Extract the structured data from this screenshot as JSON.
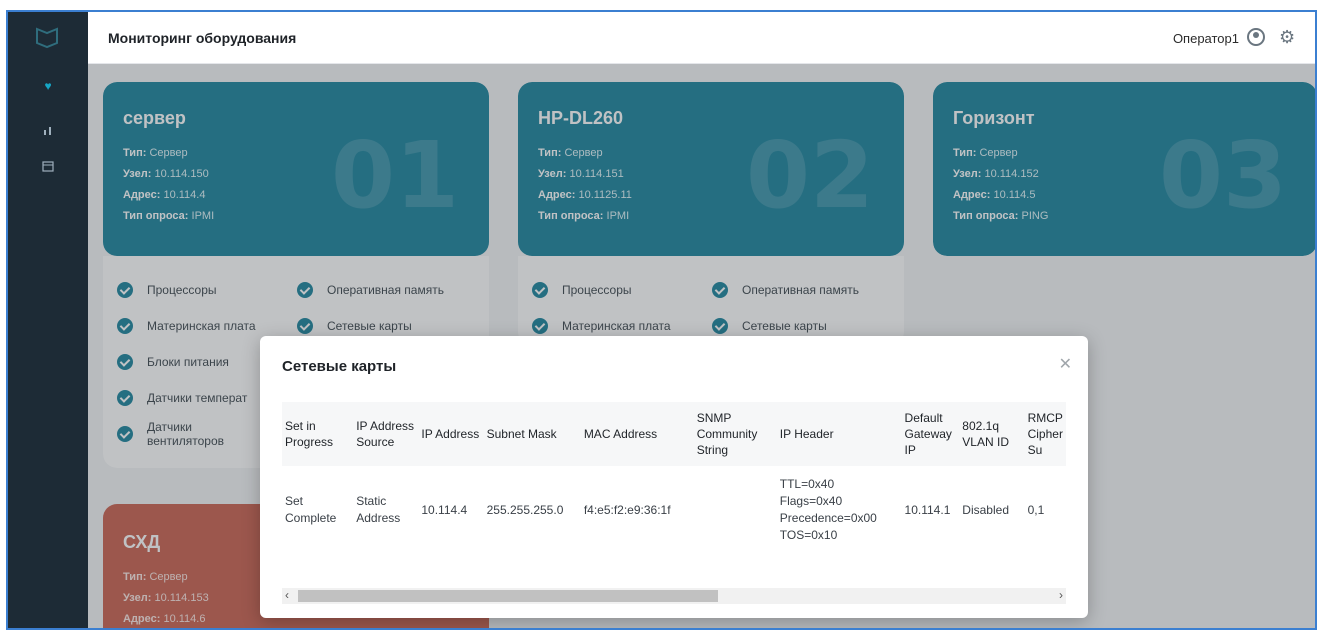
{
  "topbar": {
    "title": "Мониторинг оборудования",
    "user": "Оператор1"
  },
  "sidebar": {
    "items": [
      "logo-icon",
      "heart-icon",
      "chart-icon",
      "calendar-icon"
    ]
  },
  "labels": {
    "type": "Тип:",
    "node": "Узел:",
    "address": "Адрес:",
    "poll": "Тип опроса:"
  },
  "cards": [
    {
      "name": "сервер",
      "number": "01",
      "type": "Сервер",
      "node": "10.114.150",
      "address": "10.114.4",
      "poll": "IPMI",
      "features": [
        "Процессоры",
        "Оперативная память",
        "Материнская плата",
        "Сетевые карты",
        "Блоки питания",
        "Датчики температ",
        "Датчики вентиляторов"
      ]
    },
    {
      "name": "HP-DL260",
      "number": "02",
      "type": "Сервер",
      "node": "10.114.151",
      "address": "10.1125.11",
      "poll": "IPMI",
      "features": [
        "Процессоры",
        "Оперативная память",
        "Материнская плата",
        "Сетевые карты"
      ]
    },
    {
      "name": "Горизонт",
      "number": "03",
      "type": "Сервер",
      "node": "10.114.152",
      "address": "10.114.5",
      "poll": "PING"
    },
    {
      "name": "СХД",
      "type": "Сервер",
      "node": "10.114.153",
      "address": "10.114.6"
    }
  ],
  "modal": {
    "title": "Сетевые карты",
    "headers": [
      "Set in Progress",
      "IP Address Source",
      "IP Address",
      "Subnet Mask",
      "MAC Address",
      "SNMP Community String",
      "IP Header",
      "Default Gateway IP",
      "802.1q VLAN ID",
      "RMCP Cipher Su"
    ],
    "row": [
      "Set Complete",
      "Static Address",
      "10.114.4",
      "255.255.255.0",
      "f4:e5:f2:e9:36:1f",
      "",
      "TTL=0x40 Flags=0x40 Precedence=0x00 TOS=0x10",
      "10.114.1",
      "Disabled",
      "0,1"
    ]
  },
  "colors": {
    "card_teal": "#0e7c97",
    "card_red": "#c75846",
    "sidebar": "#1d2b36",
    "frame_border": "#3b7fd1"
  }
}
